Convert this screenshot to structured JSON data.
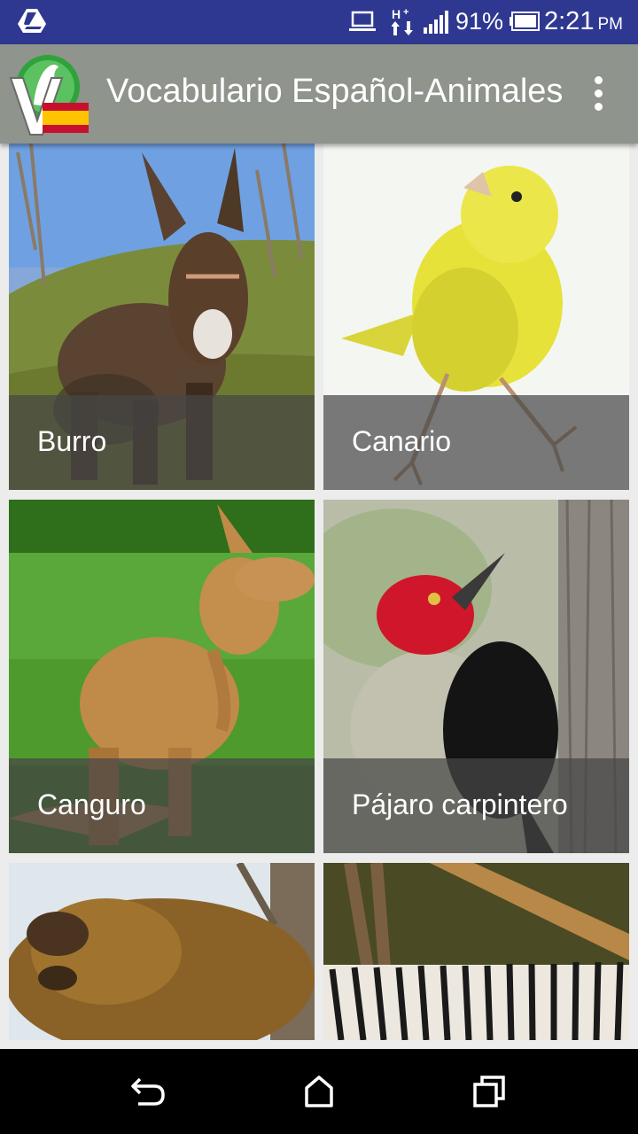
{
  "status_bar": {
    "battery_percent": "91%",
    "time": "2:21",
    "ampm": "PM",
    "icons": [
      "drive-icon",
      "laptop-icon",
      "data-transfer-icon",
      "signal-icon",
      "battery-icon"
    ]
  },
  "app_bar": {
    "title": "Vocabulario Español-Animales",
    "logo": "app-logo",
    "menu_icon": "overflow-menu-icon"
  },
  "grid": {
    "items": [
      {
        "label": "Burro",
        "image": "donkey-photo"
      },
      {
        "label": "Canario",
        "image": "canary-photo"
      },
      {
        "label": "Canguro",
        "image": "kangaroo-photo"
      },
      {
        "label": "Pájaro carpintero",
        "image": "woodpecker-photo"
      },
      {
        "label": "",
        "image": "beaver-photo"
      },
      {
        "label": "",
        "image": "zebra-photo"
      }
    ]
  },
  "nav_bar": {
    "buttons": [
      "back-icon",
      "home-icon",
      "recent-apps-icon"
    ]
  },
  "colors": {
    "status_bar": "#2f3891",
    "app_bar": "#8f948c",
    "background": "#ececec",
    "caption_overlay": "#464646"
  }
}
